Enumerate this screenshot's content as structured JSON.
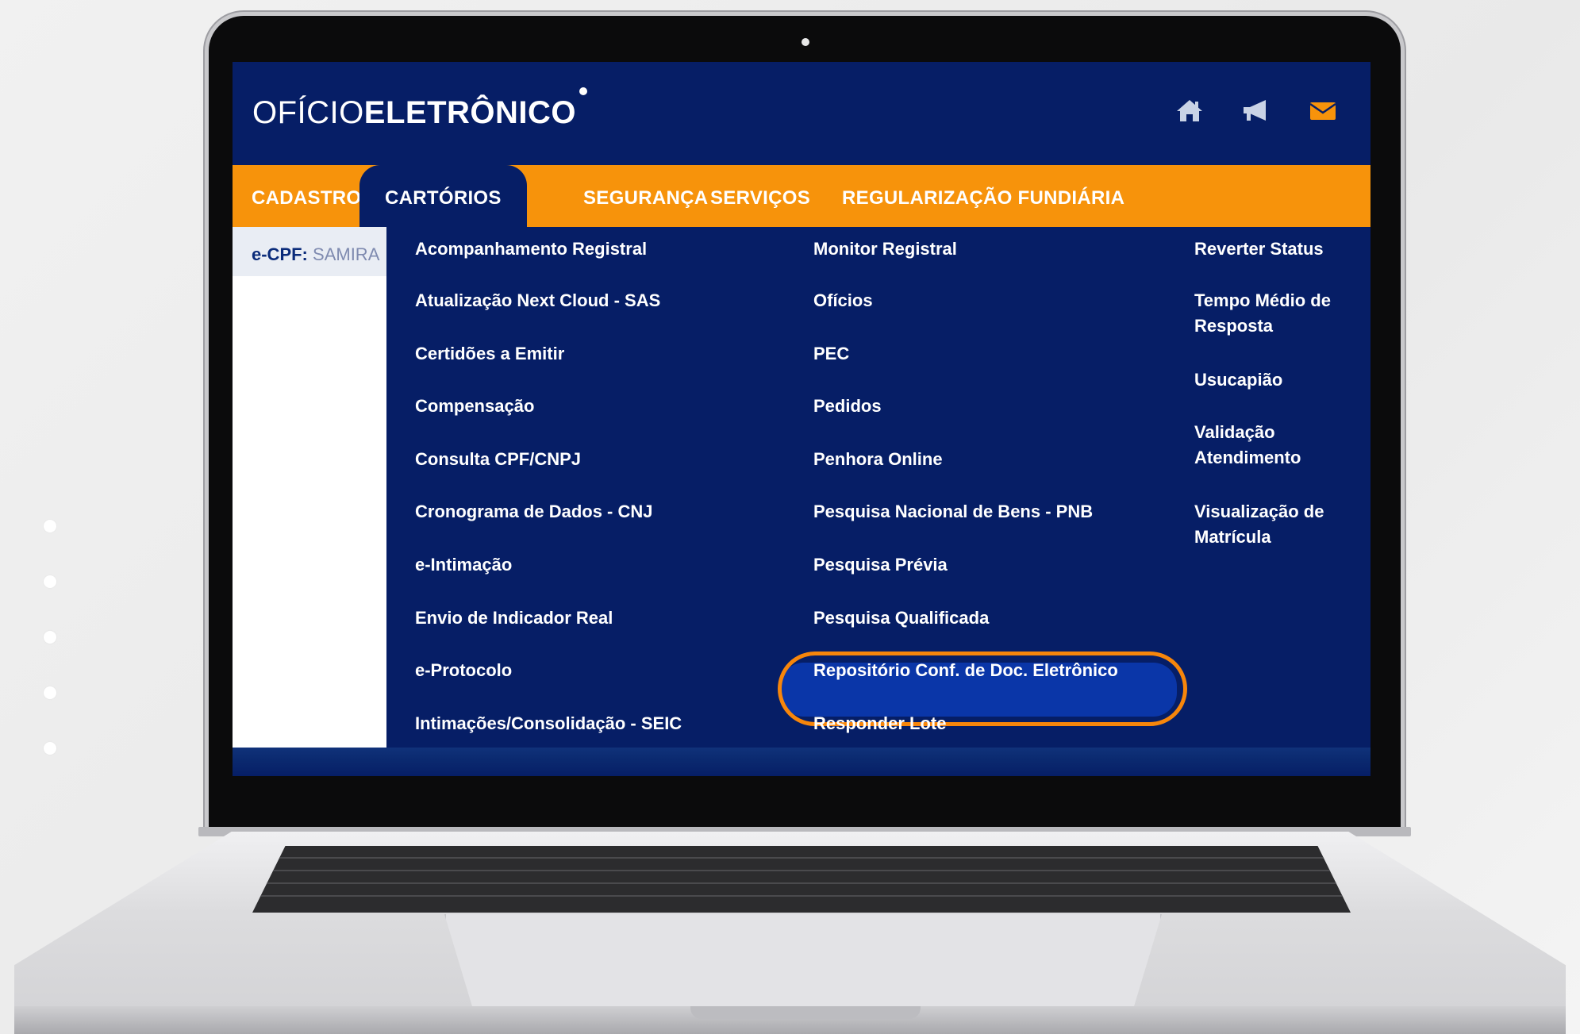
{
  "header": {
    "logo_light": "OFÍCIO",
    "logo_bold": "ELETRÔNICO",
    "icons": [
      "home-icon",
      "megaphone-icon",
      "mail-icon"
    ]
  },
  "nav": {
    "items": [
      "CADASTROS",
      "CARTÓRIOS",
      "SEGURANÇA",
      "SERVIÇOS",
      "REGULARIZAÇÃO FUNDIÁRIA"
    ],
    "active": "CARTÓRIOS"
  },
  "user": {
    "label": "e-CPF:",
    "value": "SAMIRA"
  },
  "menu": {
    "col1": [
      "Acompanhamento Registral",
      "Atualização Next Cloud - SAS",
      "Certidões a Emitir",
      "Compensação",
      "Consulta CPF/CNPJ",
      "Cronograma de Dados - CNJ",
      "e-Intimação",
      "Envio de Indicador Real",
      "e-Protocolo",
      "Intimações/Consolidação - SEIC"
    ],
    "col2": [
      "Monitor Registral",
      "Ofícios",
      "PEC",
      "Pedidos",
      "Penhora Online",
      "Pesquisa Nacional de Bens - PNB",
      "Pesquisa Prévia",
      "Pesquisa Qualificada",
      "Repositório Conf. de Doc. Eletrônico",
      "Responder Lote"
    ],
    "col3": [
      "Reverter Status",
      "Tempo Médio de Resposta",
      "Usucapião",
      "Validação Atendimento",
      "Visualização de Matrícula"
    ],
    "highlighted": "Repositório Conf. de Doc. Eletrônico"
  },
  "colors": {
    "navy": "#061e66",
    "orange": "#f7930b",
    "highlight_ring": "#f7860b",
    "highlight_fill": "#0a36a8"
  }
}
